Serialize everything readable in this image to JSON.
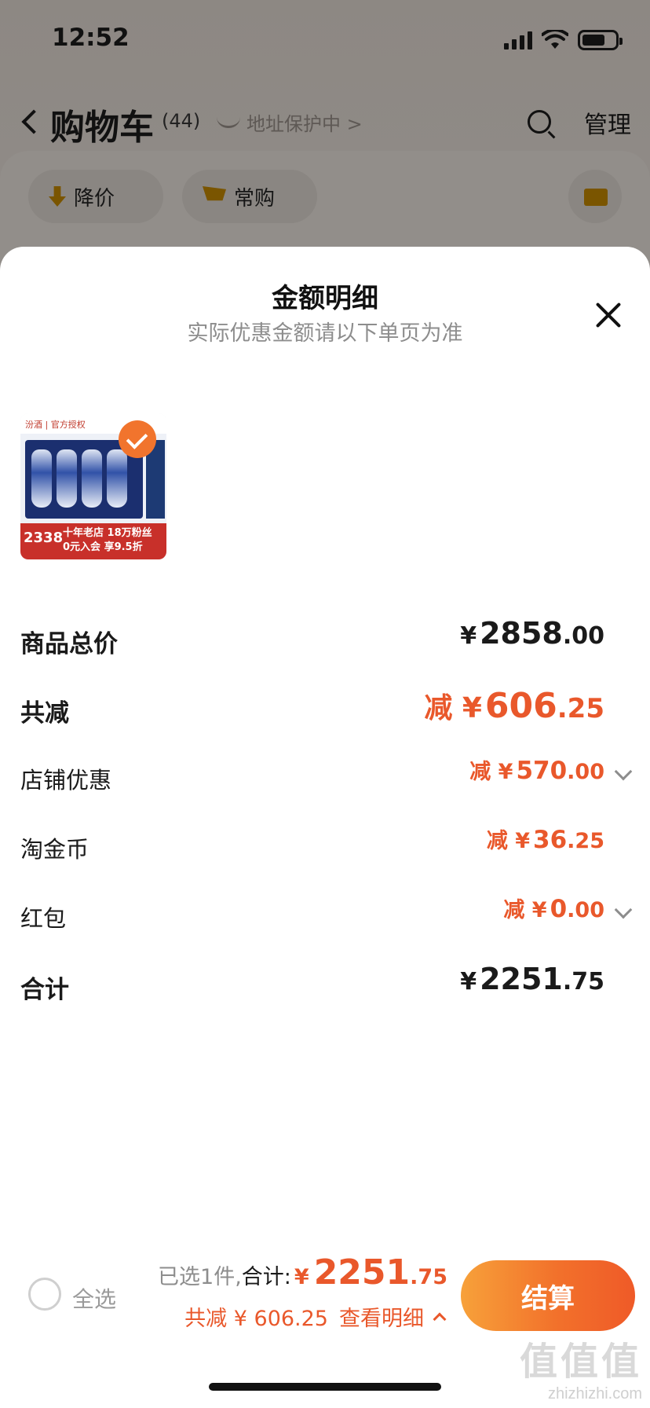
{
  "status_bar": {
    "time": "12:52"
  },
  "header": {
    "title": "购物车",
    "count": "(44)",
    "address_protection": "地址保护中 >",
    "manage_label": "管理"
  },
  "filters": {
    "price_drop_label": "降价",
    "frequent_label": "常购"
  },
  "sheet": {
    "title": "金额明细",
    "subtitle": "实际优惠金额请以下单页为准",
    "product": {
      "brand_tag": "汾酒 | 官方授权",
      "promo_price": "2338",
      "promo_line1": "十年老店 18万粉丝",
      "promo_line2": "0元入会 享9.5折"
    },
    "rows": {
      "subtotal": {
        "label": "商品总价",
        "prefix": "¥",
        "int": "2858",
        "dec": ".00"
      },
      "total_discount": {
        "label": "共减",
        "prefix": "减 ¥",
        "int": "606",
        "dec": ".25"
      },
      "shop_discount": {
        "label": "店铺优惠",
        "prefix": "减 ¥",
        "int": "570",
        "dec": ".00"
      },
      "gold_coin": {
        "label": "淘金币",
        "prefix": "减 ¥",
        "int": "36",
        "dec": ".25"
      },
      "red_packet": {
        "label": "红包",
        "prefix": "减 ¥",
        "int": "0",
        "dec": ".00"
      },
      "grand_total": {
        "label": "合计",
        "prefix": "¥",
        "int": "2251",
        "dec": ".75"
      }
    }
  },
  "bottom_bar": {
    "select_all_label": "全选",
    "selected_text": "已选1件,",
    "total_label": "合计:",
    "currency": "¥",
    "total_int": "2251",
    "total_dec": ".75",
    "discount_text": "共减 ¥ 606.25",
    "details_link": "查看明细",
    "checkout_label": "结算"
  },
  "watermark": {
    "main": "值值值",
    "sub": "zhizhizhi.com"
  },
  "colors": {
    "accent": "#e9582b",
    "checkout_start": "#f7a13a",
    "checkout_end": "#ef5a28"
  }
}
